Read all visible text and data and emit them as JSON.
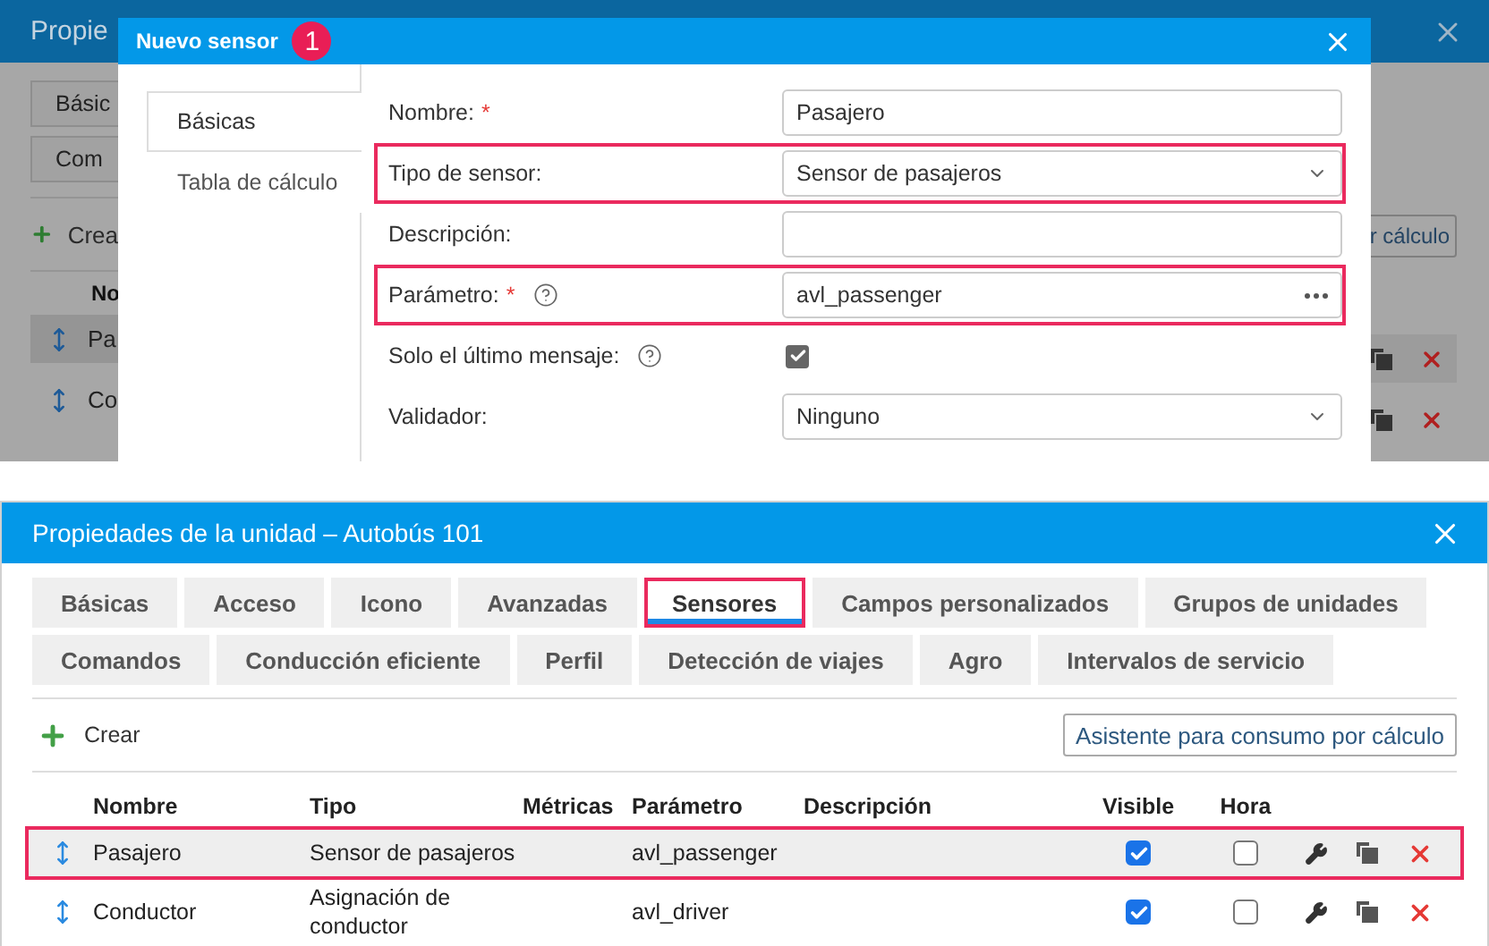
{
  "background_window": {
    "title": "Propie",
    "tabs": [
      "Básic",
      "Com"
    ],
    "create_button": "Crea",
    "column_header": "No",
    "wizard_button": "r cálculo",
    "rows": [
      {
        "name": "Pa",
        "selected": true
      },
      {
        "name": "Co",
        "selected": false
      }
    ]
  },
  "dialog": {
    "title": "Nuevo sensor",
    "step_badge": "1",
    "tabs": [
      {
        "label": "Básicas",
        "selected": true
      },
      {
        "label": "Tabla de cálculo",
        "selected": false
      }
    ],
    "fields": [
      {
        "kind": "text",
        "label": "Nombre:",
        "required_mark": "*",
        "help": false,
        "value": "Pasajero",
        "highlighted": false
      },
      {
        "kind": "select",
        "label": "Tipo de sensor:",
        "help": false,
        "value": "Sensor de pasajeros",
        "highlighted": true
      },
      {
        "kind": "text",
        "label": "Descripción:",
        "help": false,
        "highlighted": false
      },
      {
        "kind": "picker",
        "label": "Parámetro:",
        "required_mark": "*",
        "help": true,
        "value": "avl_passenger",
        "highlighted": true
      },
      {
        "kind": "checkbox",
        "label": "Solo el último mensaje:",
        "help": true,
        "checked": true,
        "highlighted": false
      },
      {
        "kind": "select",
        "label": "Validador:",
        "help": false,
        "value": "Ninguno",
        "highlighted": false
      }
    ]
  },
  "window": {
    "title": "Propiedades de la unidad – Autobús 101",
    "tab_rows": [
      [
        {
          "label": "Básicas",
          "selected": false,
          "highlighted": false
        },
        {
          "label": "Acceso",
          "selected": false,
          "highlighted": false
        },
        {
          "label": "Icono",
          "selected": false,
          "highlighted": false
        },
        {
          "label": "Avanzadas",
          "selected": false,
          "highlighted": false
        },
        {
          "label": "Sensores",
          "selected": true,
          "highlighted": true
        },
        {
          "label": "Campos personalizados",
          "selected": false,
          "highlighted": false
        },
        {
          "label": "Grupos de unidades",
          "selected": false,
          "highlighted": false
        }
      ],
      [
        {
          "label": "Comandos",
          "selected": false,
          "highlighted": false
        },
        {
          "label": "Conducción eficiente",
          "selected": false,
          "highlighted": false
        },
        {
          "label": "Perfil",
          "selected": false,
          "highlighted": false
        },
        {
          "label": "Detección de viajes",
          "selected": false,
          "highlighted": false
        },
        {
          "label": "Agro",
          "selected": false,
          "highlighted": false
        },
        {
          "label": "Intervalos de servicio",
          "selected": false,
          "highlighted": false
        }
      ]
    ],
    "create_button": "Crear",
    "wizard_button": "Asistente para consumo por cálculo",
    "table": {
      "columns": [
        "Nombre",
        "Tipo",
        "Métricas",
        "Parámetro",
        "Descripción",
        "Visible",
        "Hora"
      ],
      "rows": [
        {
          "name": "Pasajero",
          "type": "Sensor de pasajeros",
          "parameter": "avl_passenger",
          "visible": true,
          "time": false,
          "selected": true,
          "highlighted": true
        },
        {
          "name": "Conductor",
          "type": "Asignación de conductor",
          "parameter": "avl_driver",
          "visible": true,
          "time": false,
          "selected": false,
          "highlighted": false
        }
      ]
    }
  }
}
